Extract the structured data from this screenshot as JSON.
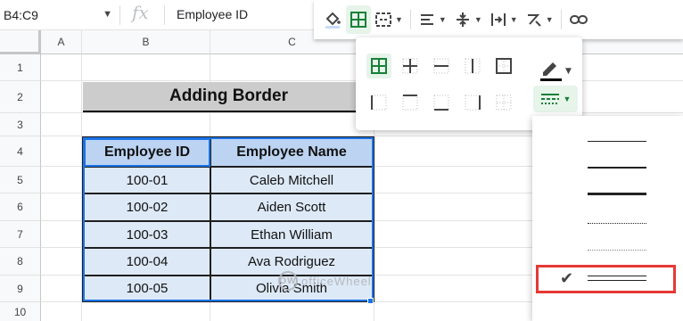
{
  "formula_bar": {
    "cell_ref": "B4:C9",
    "fx_label": "fx",
    "value": "Employee ID"
  },
  "columns": [
    "A",
    "B",
    "C"
  ],
  "rows": [
    "1",
    "2",
    "3",
    "4",
    "5",
    "6",
    "7",
    "8",
    "9",
    "10"
  ],
  "sheet": {
    "title": "Adding Border",
    "table": {
      "headers": [
        "Employee ID",
        "Employee Name"
      ],
      "rows": [
        [
          "100-01",
          "Caleb Mitchell"
        ],
        [
          "100-02",
          "Aiden Scott"
        ],
        [
          "100-03",
          "Ethan William"
        ],
        [
          "100-04",
          "Ava Rodriguez"
        ],
        [
          "100-05",
          "Olivia Smith"
        ]
      ]
    }
  },
  "toolbar": {
    "items": [
      "fill-color-icon",
      "borders-icon",
      "merge-cells-icon",
      "horizontal-align-icon",
      "vertical-align-icon",
      "text-wrapping-icon",
      "text-rotation-icon",
      "insert-link-icon"
    ]
  },
  "borders_menu": {
    "row1": [
      "all-borders-icon",
      "inner-borders-icon",
      "horizontal-borders-icon",
      "vertical-borders-icon",
      "outer-borders-icon"
    ],
    "row2": [
      "left-border-icon",
      "top-border-icon",
      "bottom-border-icon",
      "right-border-icon",
      "clear-borders-icon"
    ],
    "line_styles": [
      "thin",
      "medium",
      "thick",
      "dotted",
      "dashed",
      "double"
    ],
    "selected_style": "double",
    "accent_color": "#188038",
    "highlight_color": "#e53935"
  },
  "watermark": {
    "text": "officeWheel"
  }
}
